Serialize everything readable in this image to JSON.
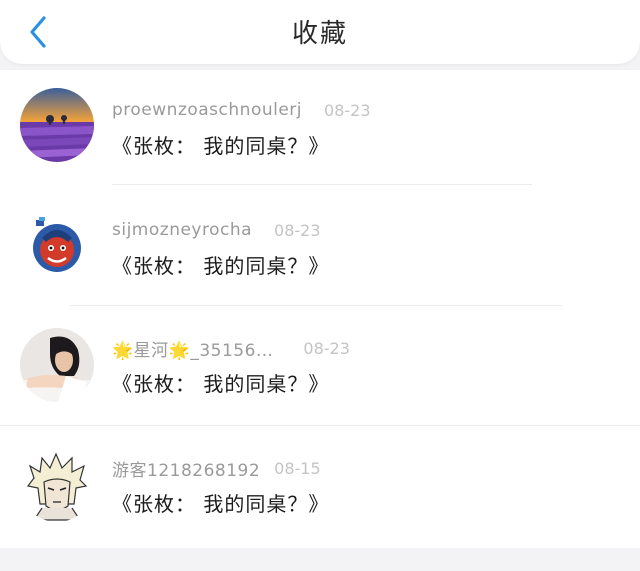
{
  "header": {
    "title": "收藏",
    "back_icon": "chevron-left-icon",
    "accent_color": "#2a8fe6"
  },
  "items": [
    {
      "avatar": "lavender-field-avatar",
      "username": "proewnzoaschnoulerj",
      "date": "08-23",
      "content": "《张枚： 我的同桌？》"
    },
    {
      "avatar": "cartoon-warrior-avatar",
      "username": "sijmozneyrocha",
      "date": "08-23",
      "content": "《张枚： 我的同桌？》"
    },
    {
      "avatar": "person-photo-avatar",
      "username": "🌟星河🌟_35156…",
      "date": "08-23",
      "content": "《张枚： 我的同桌？》"
    },
    {
      "avatar": "anime-character-avatar",
      "username": "游客1218268192",
      "date": "08-15",
      "content": "《张枚： 我的同桌？》"
    }
  ]
}
